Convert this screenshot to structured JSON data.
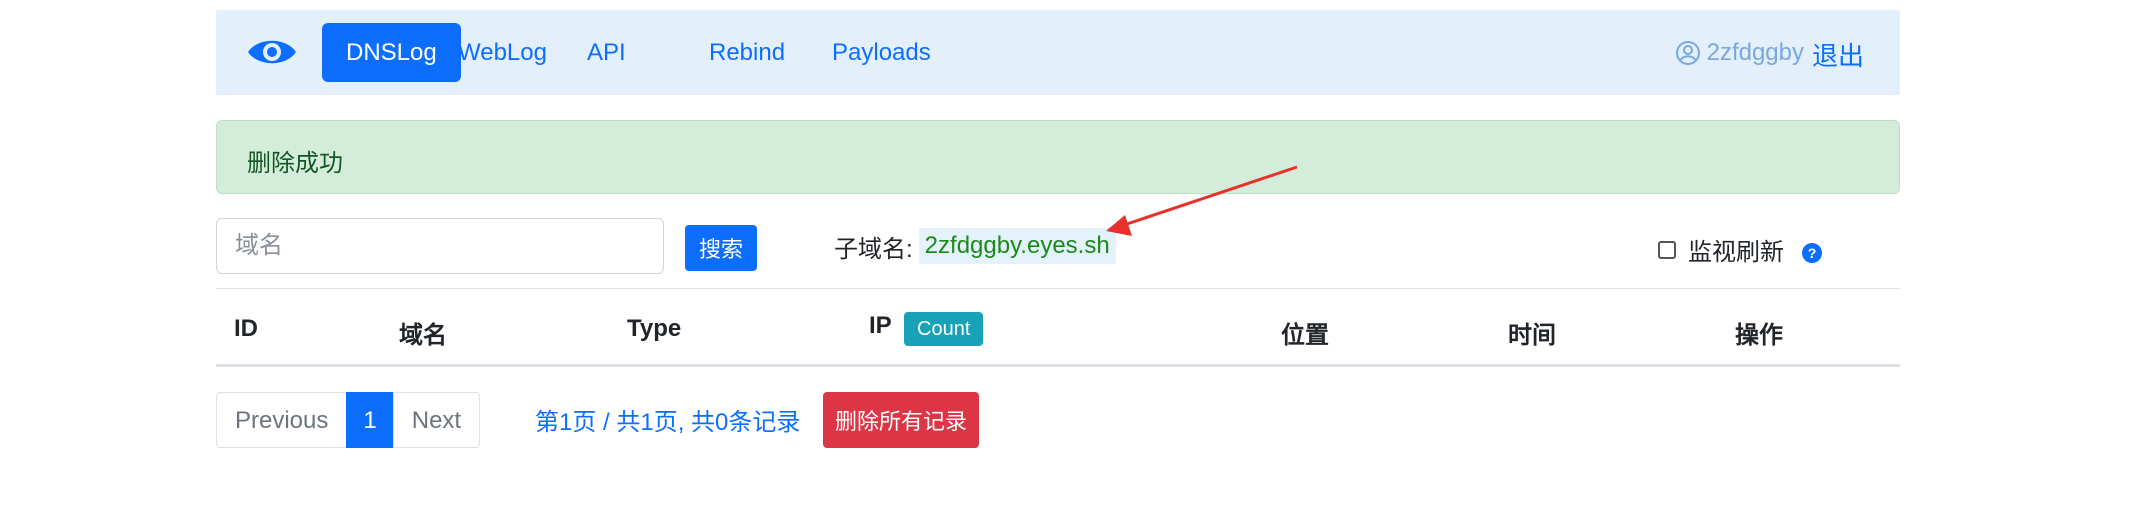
{
  "nav": {
    "brand_icon": "eye-icon",
    "links": [
      "DNSLog",
      "WebLog",
      "API",
      "Rebind",
      "Payloads"
    ],
    "active": "DNSLog",
    "user": {
      "icon": "user-circle-icon",
      "name": "2zfdggby"
    },
    "logout_label": "退出"
  },
  "alert": {
    "message": "删除成功"
  },
  "search": {
    "placeholder": "域名",
    "button_label": "搜索",
    "subdomain_label": "子域名:",
    "subdomain_value": "2zfdggby.eyes.sh",
    "monitor_label": "监视刷新",
    "monitor_checked": false,
    "help_icon": "question-circle-icon"
  },
  "table": {
    "columns": [
      "ID",
      "域名",
      "Type",
      "IP",
      "位置",
      "时间",
      "操作"
    ],
    "count_badge": "Count",
    "rows": []
  },
  "pagination": {
    "previous_label": "Previous",
    "current_page": "1",
    "next_label": "Next",
    "info": "第1页 / 共1页, 共0条记录",
    "delete_all_label": "删除所有记录"
  },
  "colors": {
    "primary": "#0d6efd",
    "navbar_bg": "#e3f0fb",
    "success_bg": "#d4edda",
    "danger": "#dc3545",
    "info": "#17a2b8",
    "annotation_arrow": "#e8312a"
  }
}
